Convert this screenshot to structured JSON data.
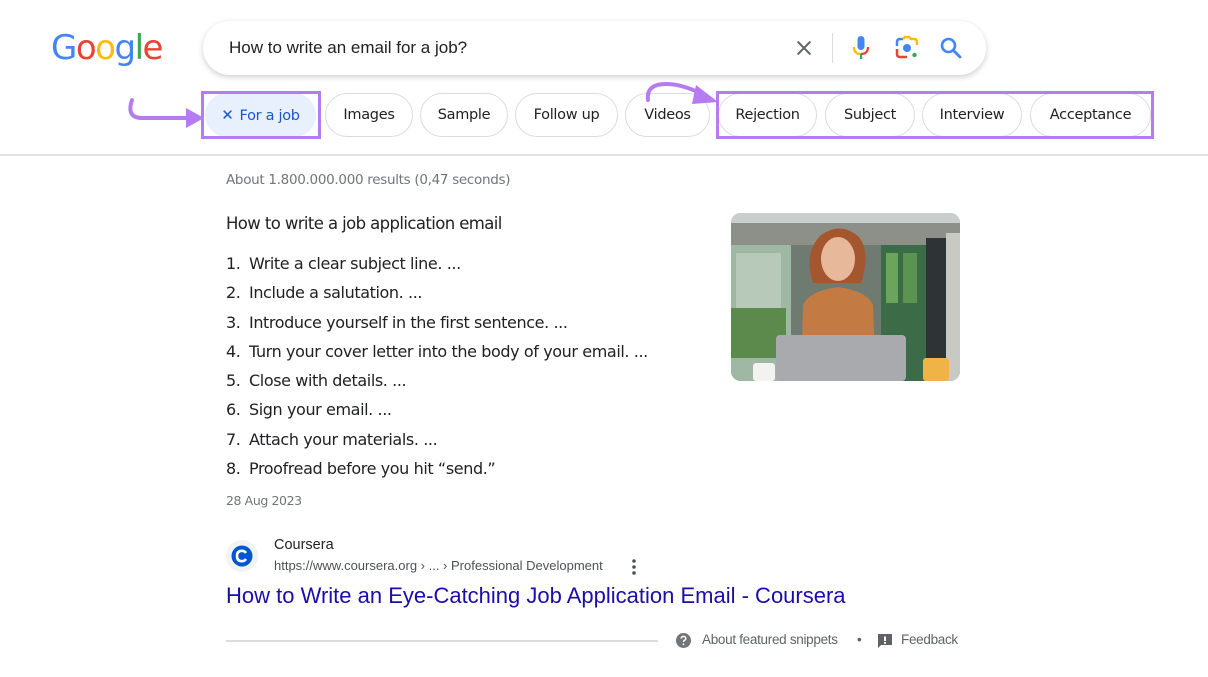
{
  "logo": {
    "letters": [
      {
        "char": "G",
        "color": "#4285f4"
      },
      {
        "char": "o",
        "color": "#ea4335"
      },
      {
        "char": "o",
        "color": "#fbbc05"
      },
      {
        "char": "g",
        "color": "#4285f4"
      },
      {
        "char": "l",
        "color": "#34a853"
      },
      {
        "char": "e",
        "color": "#ea4335"
      }
    ]
  },
  "search": {
    "query": "How to write an email for a job?",
    "icons": [
      "clear-icon",
      "microphone-icon",
      "google-lens-icon",
      "search-icon"
    ]
  },
  "chips": [
    {
      "label": "For a job",
      "active": true,
      "icon": "close-icon"
    },
    {
      "label": "Images",
      "active": false
    },
    {
      "label": "Sample",
      "active": false
    },
    {
      "label": "Follow up",
      "active": false
    },
    {
      "label": "Videos",
      "active": false
    },
    {
      "label": "Rejection",
      "active": false
    },
    {
      "label": "Subject",
      "active": false
    },
    {
      "label": "Interview",
      "active": false
    },
    {
      "label": "Acceptance",
      "active": false
    }
  ],
  "annotations": {
    "highlight_color": "#b57cf2"
  },
  "results": {
    "stats": "About 1.800.000.000 results (0,47 seconds)",
    "featured_snippet": {
      "title": "How to write a job application email",
      "steps": [
        {
          "num": "1.",
          "text": "Write a clear subject line. ..."
        },
        {
          "num": "2.",
          "text": "Include a salutation. ..."
        },
        {
          "num": "3.",
          "text": "Introduce yourself in the first sentence. ..."
        },
        {
          "num": "4.",
          "text": "Turn your cover letter into the body of your email. ..."
        },
        {
          "num": "5.",
          "text": "Close with details. ..."
        },
        {
          "num": "6.",
          "text": "Sign your email. ..."
        },
        {
          "num": "7.",
          "text": "Attach your materials. ..."
        },
        {
          "num": "8.",
          "text": "Proofread before you hit “send.”"
        }
      ],
      "date": "28 Aug 2023",
      "image_alt": "Smiling woman working on a laptop"
    },
    "source": {
      "favicon_letter": "C",
      "favicon_color": "#0056d2",
      "site_name": "Coursera",
      "url": "https://www.coursera.org › ... › Professional Development",
      "title": "How to Write an Eye-Catching Job Application Email - Coursera",
      "link_color": "#1a0dab"
    },
    "footer": {
      "about_label": "About featured snippets",
      "separator": "•",
      "feedback_label": "Feedback"
    }
  }
}
